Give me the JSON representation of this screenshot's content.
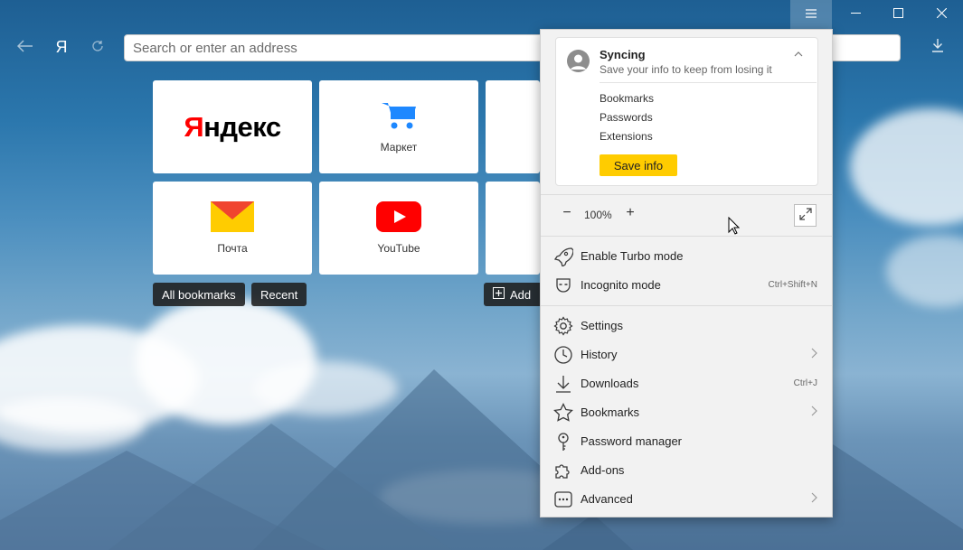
{
  "window": {
    "menu_icon": "hamburger-icon",
    "minimize_icon": "minimize-icon",
    "maximize_icon": "maximize-icon",
    "close_icon": "close-icon"
  },
  "toolbar": {
    "back_icon": "arrow-left-icon",
    "yandex_letter": "Я",
    "reload_icon": "reload-icon",
    "address_placeholder": "Search or enter an address",
    "download_icon": "download-icon"
  },
  "tiles": [
    {
      "name": "yandex",
      "logo_red": "Я",
      "logo_black": "ндекс"
    },
    {
      "name": "market",
      "label": "Маркет"
    },
    {
      "name": "mail",
      "label": "Почта"
    },
    {
      "name": "youtube",
      "label": "YouTube"
    }
  ],
  "buttons": {
    "all_bookmarks": "All bookmarks",
    "recent": "Recent",
    "add": "Add"
  },
  "menu": {
    "sync": {
      "title": "Syncing",
      "subtitle": "Save your info to keep from losing it",
      "items": [
        "Bookmarks",
        "Passwords",
        "Extensions"
      ],
      "save_button": "Save info"
    },
    "zoom": {
      "minus": "−",
      "value": "100%",
      "plus": "+"
    },
    "items": [
      {
        "label": "Enable Turbo mode",
        "icon": "rocket-icon",
        "shortcut": "",
        "submenu": false
      },
      {
        "label": "Incognito mode",
        "icon": "incognito-icon",
        "shortcut": "Ctrl+Shift+N",
        "submenu": false
      },
      {
        "label": "Settings",
        "icon": "gear-icon",
        "shortcut": "",
        "submenu": false
      },
      {
        "label": "History",
        "icon": "clock-icon",
        "shortcut": "",
        "submenu": true
      },
      {
        "label": "Downloads",
        "icon": "download-icon",
        "shortcut": "Ctrl+J",
        "submenu": false
      },
      {
        "label": "Bookmarks",
        "icon": "star-icon",
        "shortcut": "",
        "submenu": true
      },
      {
        "label": "Password manager",
        "icon": "key-icon",
        "shortcut": "",
        "submenu": false
      },
      {
        "label": "Add-ons",
        "icon": "puzzle-icon",
        "shortcut": "",
        "submenu": false
      },
      {
        "label": "Advanced",
        "icon": "more-icon",
        "shortcut": "",
        "submenu": true
      }
    ]
  },
  "colors": {
    "accent_yellow": "#ffcc00",
    "yandex_red": "#ff0000",
    "youtube_red": "#ff0000",
    "market_blue": "#1e88ff"
  }
}
